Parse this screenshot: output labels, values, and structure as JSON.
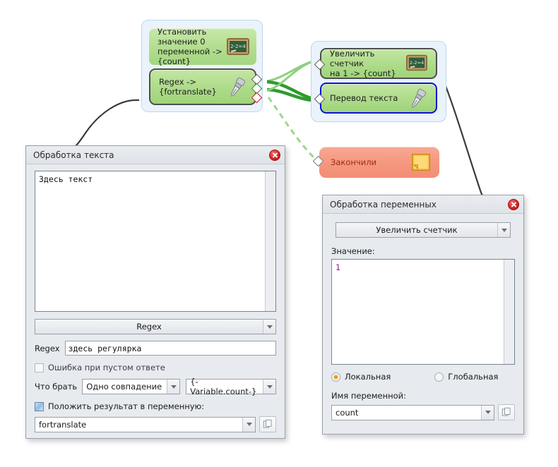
{
  "canvas": {
    "groups": [
      {
        "id": "group-left",
        "nodes": [
          {
            "label": "Установить значение 0\nпеременной -> {count}",
            "icon": "blackboard-icon",
            "style": "flat"
          },
          {
            "label": "Regex ->\n{fortranslate}",
            "icon": "pen-nib-icon",
            "style": "bordered"
          }
        ]
      },
      {
        "id": "group-right",
        "nodes": [
          {
            "label": "Увеличить счетчик\nна 1 -> {count}",
            "icon": "blackboard-icon",
            "style": "bordered"
          },
          {
            "label": "Перевод текста",
            "icon": "pen-nib-icon",
            "style": "selected"
          }
        ]
      }
    ],
    "end_node": {
      "label": "Закончили",
      "icon": "note-icon"
    }
  },
  "text_dialog": {
    "title": "Обработка текста",
    "close_icon": "close-icon",
    "textarea_value": "Здесь текст",
    "mode_combo": {
      "value": "Regex",
      "arrow_icon": "chevron-down-icon"
    },
    "regex_label": "Regex",
    "regex_value": "здесь регулярка",
    "error_checkbox": {
      "label": "Ошибка при пустом ответе",
      "checked": false
    },
    "take_label": "Что брать",
    "take_combo": {
      "value": "Одно совпадение",
      "arrow_icon": "chevron-down-icon"
    },
    "variable_combo": {
      "value": "{-Variable.count-}",
      "arrow_icon": "chevron-down-icon"
    },
    "result_checkbox": {
      "label": "Положить результат в переменную:",
      "checked": true
    },
    "result_combo": {
      "value": "fortranslate",
      "arrow_icon": "chevron-down-icon"
    },
    "copy_icon": "copy-icon"
  },
  "vars_dialog": {
    "title": "Обработка переменных",
    "close_icon": "close-icon",
    "action_combo": {
      "value": "Увеличить счетчик",
      "arrow_icon": "chevron-down-icon"
    },
    "value_label": "Значение:",
    "value_text": "1",
    "scope_local": {
      "label": "Локальная",
      "selected": true
    },
    "scope_global": {
      "label": "Глобальная",
      "selected": false
    },
    "varname_label": "Имя переменной:",
    "varname_combo": {
      "value": "count",
      "arrow_icon": "chevron-down-icon"
    },
    "copy_icon": "copy-icon"
  },
  "colors": {
    "node_green": "#b1dd8d",
    "node_end_red": "#f59880",
    "group_blue": "#eaf3fb",
    "selected_border": "#0a12d8",
    "dialog_bg": "#e7eaee",
    "radio_on": "#f0960a",
    "value_text": "#8d1a8d"
  }
}
